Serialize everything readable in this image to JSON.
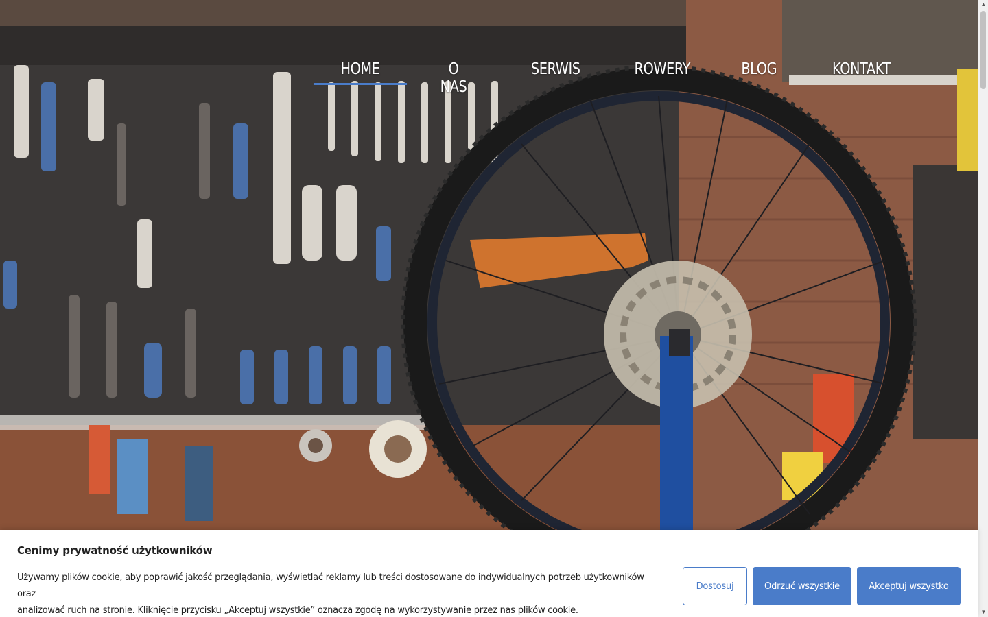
{
  "nav": {
    "items": [
      {
        "label": "HOME",
        "active": true
      },
      {
        "label": "O NAS",
        "active": false
      },
      {
        "label": "SERWIS",
        "active": false
      },
      {
        "label": "ROWERY",
        "active": false
      },
      {
        "label": "BLOG",
        "active": false
      },
      {
        "label": "KONTAKT",
        "active": false
      }
    ]
  },
  "hero": {
    "image": "bicycle-workshop-photo"
  },
  "cookie_banner": {
    "title": "Cenimy prywatność użytkowników",
    "text_line1": "Używamy plików cookie, aby poprawić jakość przeglądania, wyświetlać reklamy lub treści dostosowane do indywidualnych potrzeb użytkowników oraz",
    "text_line2": "analizować ruch na stronie. Kliknięcie przycisku „Akceptuj wszystkie” oznacza zgodę na wykorzystywanie przez nas plików cookie.",
    "customize_label": "Dostosuj",
    "reject_label": "Odrzuć wszystkie",
    "accept_label": "Akceptuj wszystko"
  },
  "colors": {
    "accent": "#4a7cc9",
    "nav_text": "#ffffff",
    "banner_bg": "#ffffff",
    "banner_text": "#212121"
  }
}
